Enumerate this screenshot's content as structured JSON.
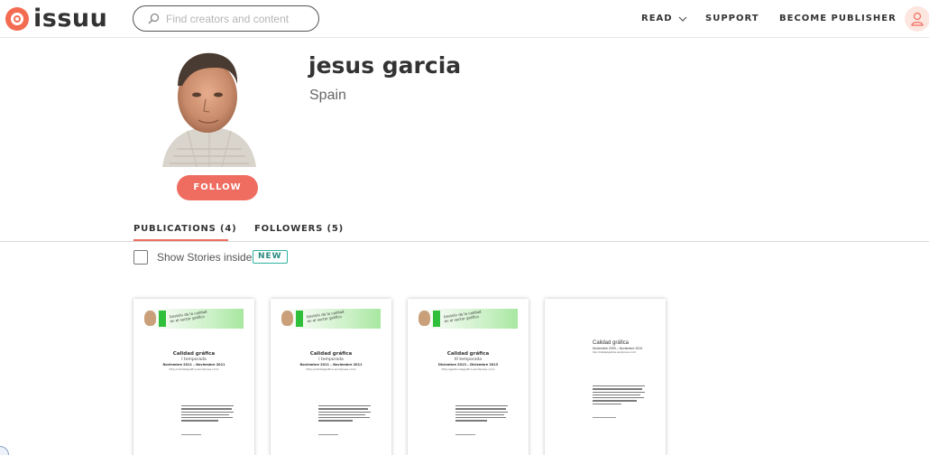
{
  "brand": {
    "name": "issuu",
    "accent": "#f36c51"
  },
  "search": {
    "placeholder": "Find creators and content",
    "icon": "search-icon"
  },
  "nav": {
    "read": "READ",
    "support": "SUPPORT",
    "become_publisher": "BECOME PUBLISHER"
  },
  "profile": {
    "name": "jesus garcia",
    "location": "Spain",
    "follow_label": "FOLLOW"
  },
  "tabs": [
    {
      "label": "PUBLICATIONS (4)",
      "active": true
    },
    {
      "label": "FOLLOWERS (5)",
      "active": false
    }
  ],
  "filter": {
    "show_stories_label": "Show Stories inside",
    "checked": false,
    "new_badge": "NEW"
  },
  "publications": [
    {
      "banner_heading": "Gestión de la calidad en el sector gráfico",
      "title": "Calidad gráfica",
      "subtitle": "I temporada",
      "dates": "Noviembre 2011 – Noviembre 2011",
      "url": "http://calidadgrafica.wordpress.com/"
    },
    {
      "banner_heading": "Gestión de la calidad en el sector gráfico",
      "title": "Calidad gráfica",
      "subtitle": "I temporada",
      "dates": "Noviembre 2011 – Noviembre 2011",
      "url": "http://calidadgrafica.wordpress.com/"
    },
    {
      "banner_heading": "Gestión de la calidad en el sector gráfico",
      "title": "Calidad gráfica",
      "subtitle": "III temporada",
      "dates": "Diciembre 2013 – Diciembre 2013",
      "url": "http://gestiondegrafica.wordpress.com/"
    },
    {
      "title": "Calidad gráfica",
      "dates": "Noviembre 2009 – Noviembre 2010",
      "url": "http://calidadgrafica.wordpress.com/"
    }
  ]
}
